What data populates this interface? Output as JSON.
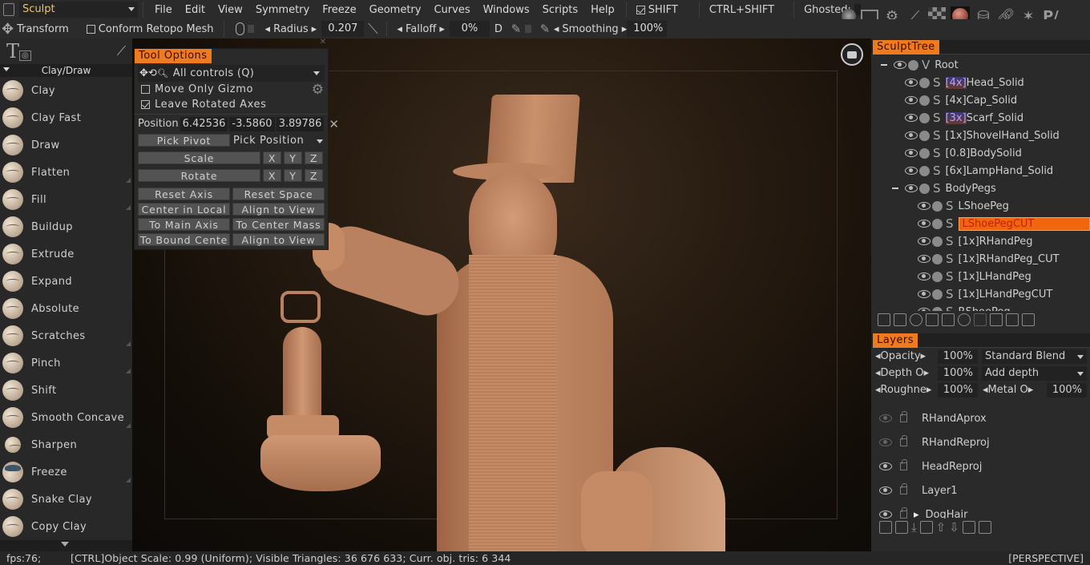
{
  "menubar": {
    "room": "Sculpt",
    "items": [
      "File",
      "Edit",
      "View",
      "Symmetry",
      "Freeze",
      "Geometry",
      "Curves",
      "Windows",
      "Scripts",
      "Help"
    ],
    "shift_label": "SHIFT",
    "ctrl_shift_label": "CTRL+SHIFT",
    "ghosted_label": "Ghosted:"
  },
  "toolbar": {
    "transform_label": "Transform",
    "conform_label": "Conform  Retopo  Mesh",
    "radius_label": "Radius",
    "radius_value": "0.207",
    "falloff_label": "Falloff",
    "falloff_value": "0%",
    "depth_label": "D",
    "smoothing_label": "Smoothing",
    "smoothing_value": "100%"
  },
  "left_panel": {
    "category": "Clay/Draw",
    "tools": [
      {
        "label": "Clay"
      },
      {
        "label": "Clay  Fast"
      },
      {
        "label": "Draw"
      },
      {
        "label": "Flatten"
      },
      {
        "label": "Fill"
      },
      {
        "label": "Buildup"
      },
      {
        "label": "Extrude"
      },
      {
        "label": "Expand"
      },
      {
        "label": "Absolute"
      },
      {
        "label": "Scratches"
      },
      {
        "label": "Pinch"
      },
      {
        "label": "Shift"
      },
      {
        "label": "Smooth  Concave"
      },
      {
        "label": "Sharpen"
      },
      {
        "label": "Freeze"
      },
      {
        "label": "Snake  Clay"
      },
      {
        "label": "Copy  Clay"
      }
    ]
  },
  "tool_options": {
    "tab": "Tool  Options",
    "controls_select": "All  controls  (Q)",
    "move_only_gizmo": "Move  Only  Gizmo",
    "move_only_gizmo_checked": false,
    "leave_rotated_axes": "Leave  Rotated  Axes",
    "leave_rotated_axes_checked": true,
    "position_label": "Position",
    "position": [
      "6.42536",
      "-3.5860",
      "3.89786"
    ],
    "pick_pivot": "Pick  Pivot",
    "pick_position": "Pick  Position",
    "scale": "Scale",
    "rotate": "Rotate",
    "axes": [
      "X",
      "Y",
      "Z"
    ],
    "buttons": [
      "Reset  Axis",
      "Reset  Space",
      "Center  in  Local",
      "Align  to  View",
      "To  Main  Axis",
      "To  Center  Mass",
      "To  Bound  Cente",
      "Align  to  View"
    ]
  },
  "sculpt_tree": {
    "tab": "SculptTree",
    "root": {
      "sym": "V",
      "label": "Root"
    },
    "items": [
      {
        "sym": "S",
        "prefix": "[4x]",
        "label": "Head_Solid",
        "highlight_prefix": true
      },
      {
        "sym": "S",
        "prefix": "[4x]",
        "label": "Cap_Solid",
        "highlight_prefix": false
      },
      {
        "sym": "S",
        "prefix": "[3x]",
        "label": "Scarf_Solid",
        "highlight_prefix": true
      },
      {
        "sym": "S",
        "prefix": "[1x]",
        "label": "ShovelHand_Solid",
        "highlight_prefix": false
      },
      {
        "sym": "S",
        "prefix": "[0.8]",
        "label": "BodySolid",
        "highlight_prefix": false
      },
      {
        "sym": "S",
        "prefix": "[6x]",
        "label": "LampHand_Solid",
        "highlight_prefix": false
      }
    ],
    "group": {
      "sym": "S",
      "label": "BodyPegs"
    },
    "children": [
      {
        "sym": "S",
        "label": "LShoePeg",
        "selected": false
      },
      {
        "sym": "S",
        "label": "LShoePegCUT",
        "selected": true
      },
      {
        "sym": "S",
        "label": "[1x]RHandPeg",
        "selected": false
      },
      {
        "sym": "S",
        "label": "[1x]RHandPeg_CUT",
        "selected": false
      },
      {
        "sym": "S",
        "label": "[1x]LHandPeg",
        "selected": false
      },
      {
        "sym": "S",
        "label": "[1x]LHandPegCUT",
        "selected": false
      },
      {
        "sym": "S",
        "label": "RShoePeg",
        "selected": false
      }
    ]
  },
  "layers": {
    "tab": "Layers",
    "opacity_label": "Opacity",
    "opacity_value": "100%",
    "blend_mode": "Standard  Blend",
    "depth_label": "Depth  O",
    "depth_value": "100%",
    "depth_mode": "Add  depth",
    "roughness_label": "Roughne",
    "roughness_value": "100%",
    "metal_label": "Metal  O",
    "metal_value": "100%",
    "items": [
      {
        "label": "RHandAprox",
        "visible": false
      },
      {
        "label": "RHandReproj",
        "visible": false
      },
      {
        "label": "HeadReproj",
        "visible": true
      },
      {
        "label": "Layer1",
        "visible": true
      },
      {
        "label": "DogHair",
        "visible": true,
        "folder": true
      }
    ]
  },
  "status": {
    "fps": "fps:76;",
    "message": "[CTRL]Object  Scale:  0.99  (Uniform);  Visible  Triangles:  36  676  633;  Curr.  obj.  tris:  6  344",
    "projection": "[PERSPECTIVE]"
  },
  "colors": {
    "accent": "#f07b1e",
    "selected": "#f0660e",
    "room_text": "#f0c26a"
  }
}
